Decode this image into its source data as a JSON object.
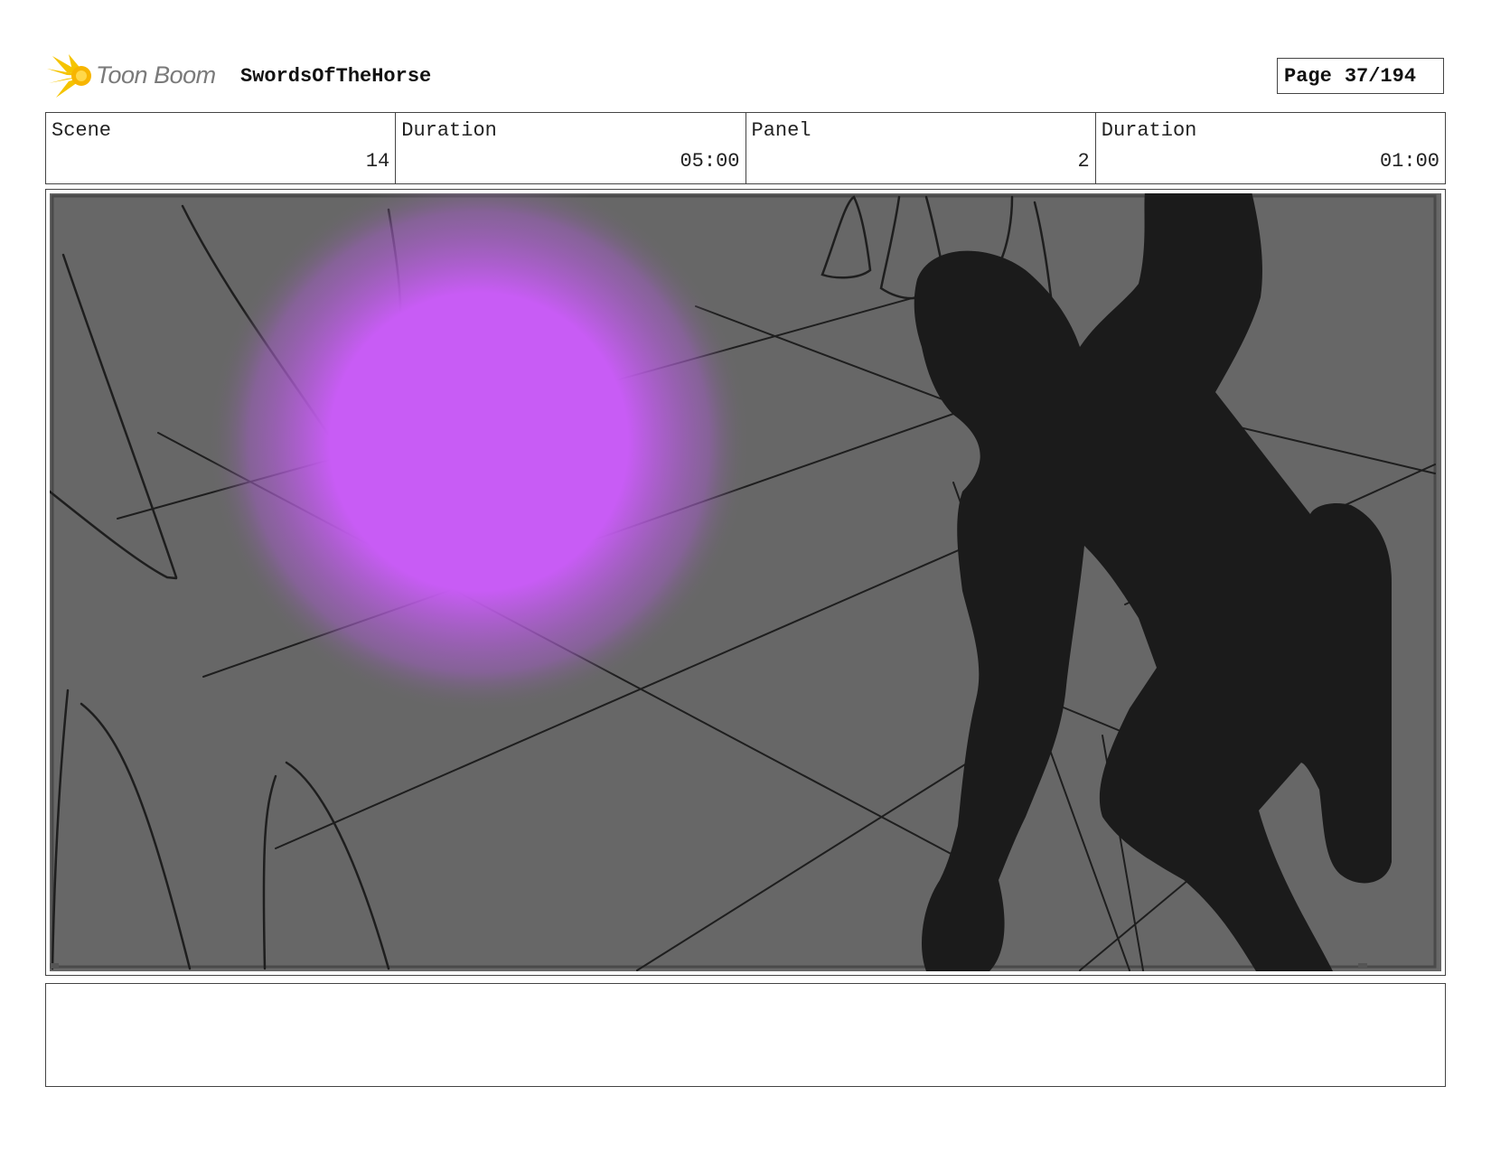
{
  "header": {
    "logo_text": "Toon Boom",
    "project_title": "SwordsOfTheHorse",
    "page_label": "Page",
    "page_value": "37/194"
  },
  "info": {
    "scene_label": "Scene",
    "scene_value": "14",
    "scene_duration_label": "Duration",
    "scene_duration_value": "05:00",
    "panel_label": "Panel",
    "panel_value": "2",
    "panel_duration_label": "Duration",
    "panel_duration_value": "01:00"
  },
  "colors": {
    "logo_accent": "#f5c400",
    "panel_background": "#676767",
    "glow": "#c85cf5",
    "silhouette": "#1b1b1b"
  },
  "notes": {
    "text": ""
  }
}
